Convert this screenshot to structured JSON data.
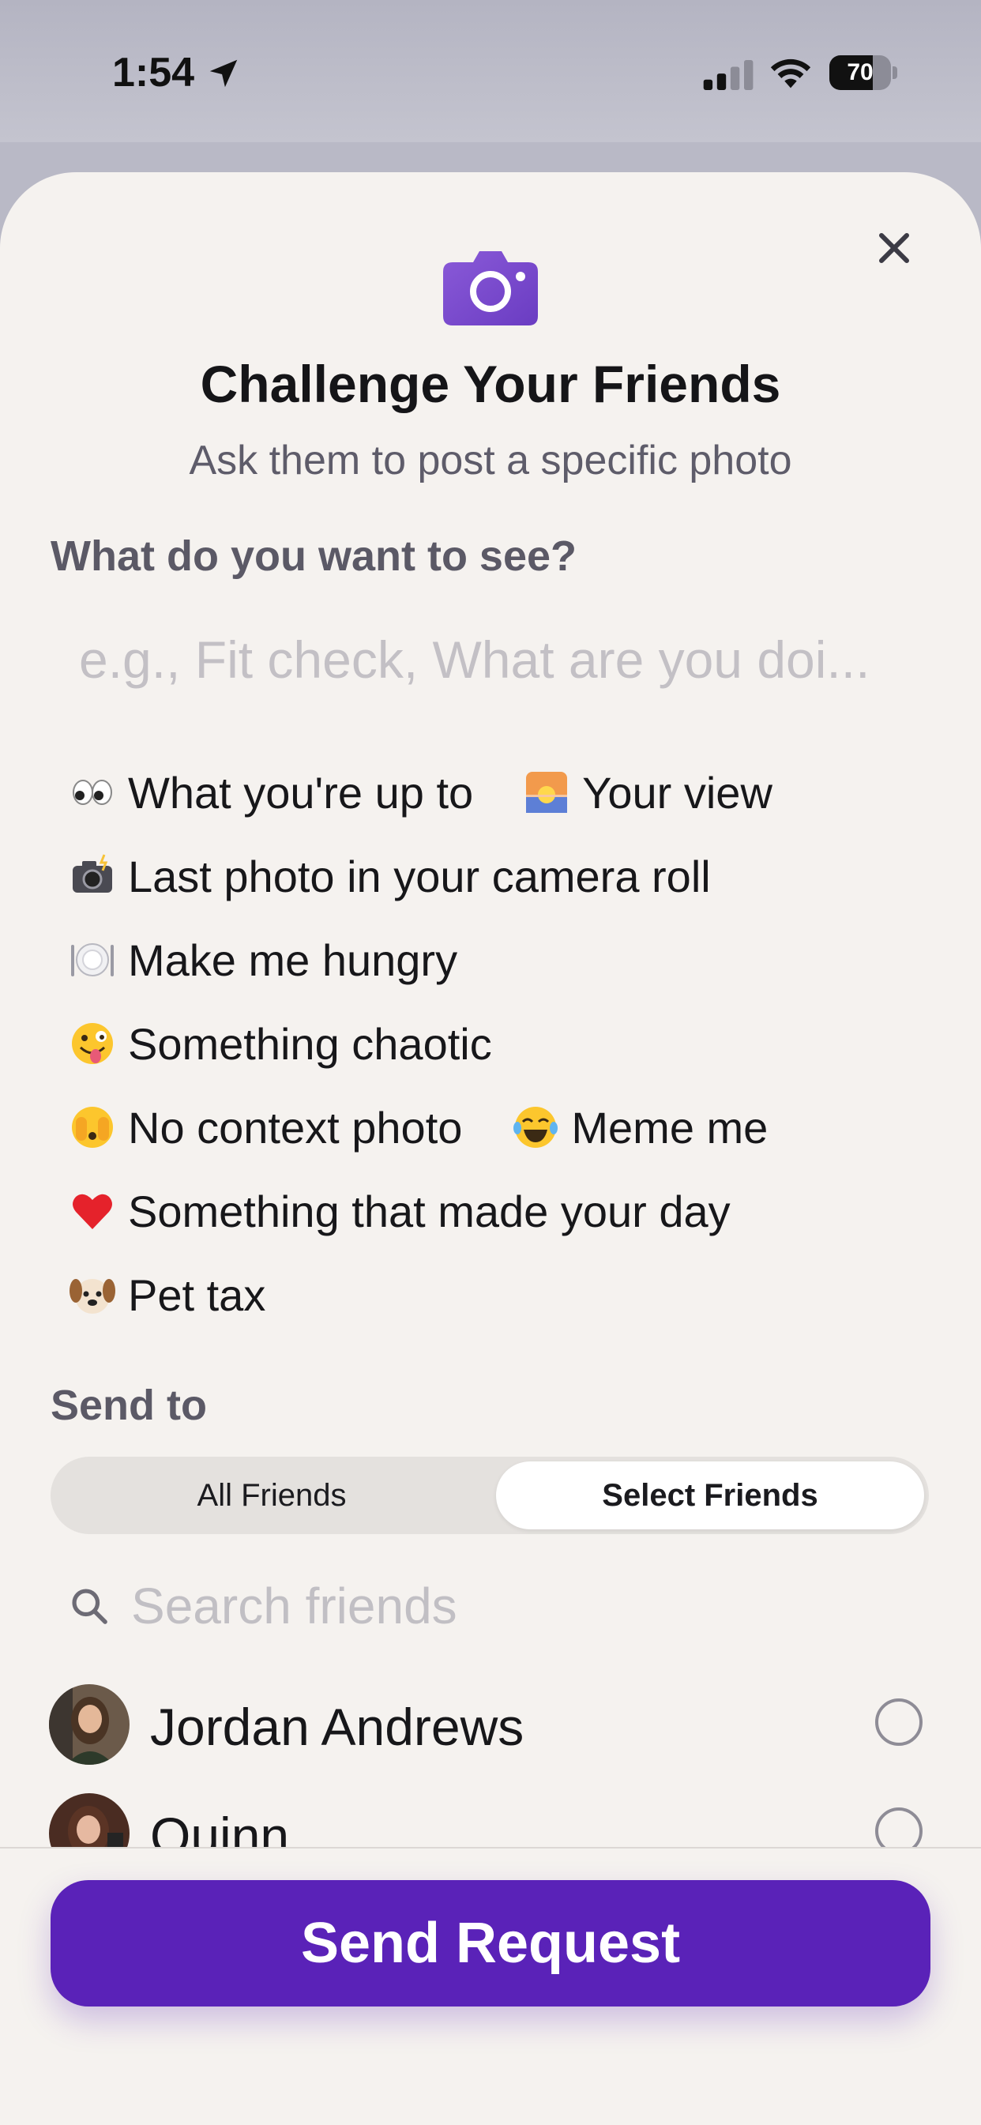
{
  "status_bar": {
    "time": "1:54",
    "battery_level": "70",
    "battery_percent": 70
  },
  "sheet": {
    "title": "Challenge Your Friends",
    "subtitle": "Ask them to post a specific photo",
    "prompt_label": "What do you want to see?",
    "prompt_placeholder": "e.g., Fit check, What are you doi...",
    "prompt_value": "",
    "suggestions": [
      {
        "emoji": "eyes-icon",
        "label": "What you're up to"
      },
      {
        "emoji": "sunrise-icon",
        "label": "Your view"
      },
      {
        "emoji": "camera-flash-icon",
        "label": "Last photo in your camera roll"
      },
      {
        "emoji": "plate-icon",
        "label": "Make me hungry"
      },
      {
        "emoji": "zany-face-icon",
        "label": "Something chaotic"
      },
      {
        "emoji": "peeking-face-icon",
        "label": "No context photo"
      },
      {
        "emoji": "laughing-face-icon",
        "label": "Meme me"
      },
      {
        "emoji": "heart-icon",
        "label": "Something that made your day"
      },
      {
        "emoji": "dog-face-icon",
        "label": "Pet tax"
      }
    ],
    "send_to_label": "Send to",
    "segments": {
      "all": "All Friends",
      "select": "Select Friends",
      "selected": "select"
    },
    "search_placeholder": "Search friends",
    "friends": [
      {
        "name": "Jordan Andrews",
        "selected": false
      },
      {
        "name": "Quinn",
        "selected": false
      }
    ],
    "send_button": "Send Request"
  },
  "colors": {
    "accent": "#5a22b8",
    "camera_icon": "#7d4fd0",
    "sheet_bg": "#f5f2ef"
  }
}
